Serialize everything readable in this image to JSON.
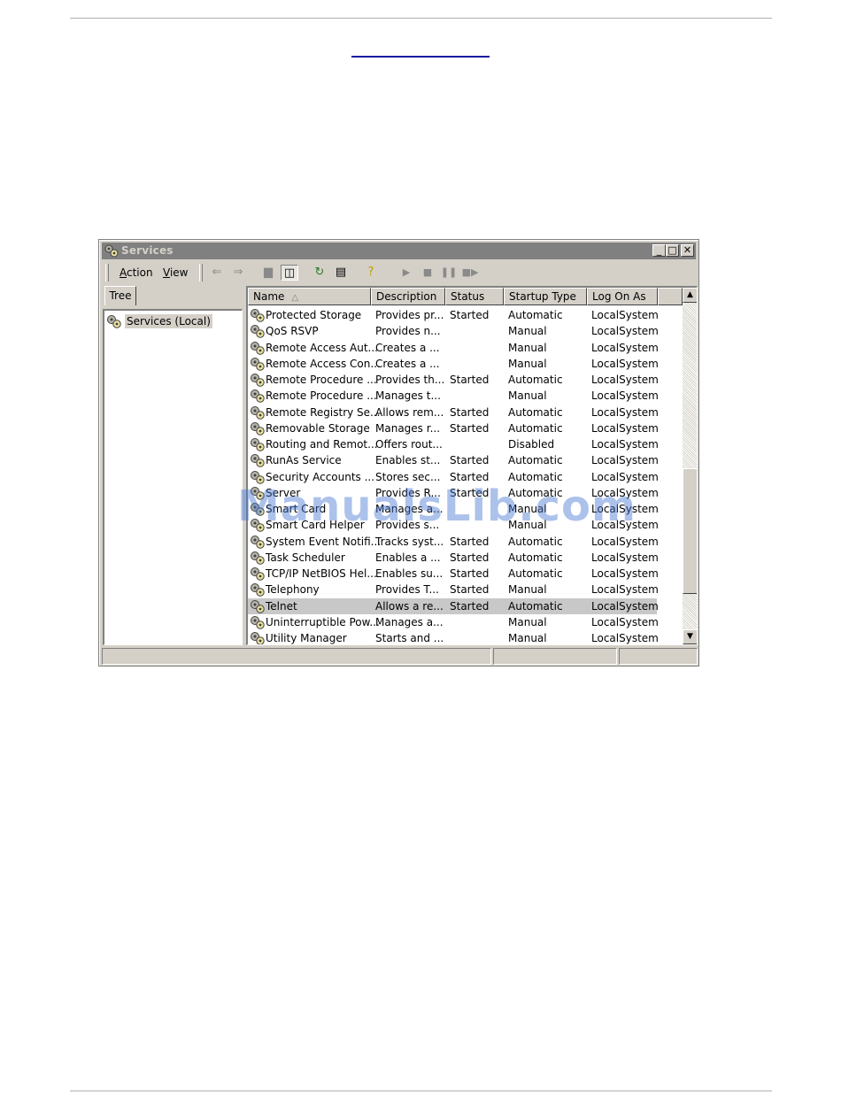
{
  "window": {
    "title": "Services",
    "minimize_glyph": "_",
    "maximize_glyph": "□",
    "close_glyph": "✕"
  },
  "menu": {
    "action": {
      "first": "A",
      "rest": "ction"
    },
    "view": {
      "first": "V",
      "rest": "iew"
    }
  },
  "toolbar_icons": [
    "back-arrow-icon",
    "forward-arrow-icon",
    "up-folder-icon",
    "show-hide-tree-icon",
    "refresh-icon",
    "export-list-icon",
    "help-icon",
    "start-service-icon",
    "stop-service-icon",
    "pause-service-icon",
    "restart-service-icon"
  ],
  "tree": {
    "tab_label": "Tree",
    "root_label": "Services (Local)"
  },
  "columns": {
    "name": "Name",
    "description": "Description",
    "status": "Status",
    "startup_type": "Startup Type",
    "log_on_as": "Log On As",
    "sort_glyph": "△"
  },
  "services": [
    {
      "name": "Protected Storage",
      "description": "Provides pr...",
      "status": "Started",
      "startup": "Automatic",
      "logon": "LocalSystem"
    },
    {
      "name": "QoS RSVP",
      "description": "Provides n...",
      "status": "",
      "startup": "Manual",
      "logon": "LocalSystem"
    },
    {
      "name": "Remote Access Aut...",
      "description": "Creates a ...",
      "status": "",
      "startup": "Manual",
      "logon": "LocalSystem"
    },
    {
      "name": "Remote Access Con...",
      "description": "Creates a ...",
      "status": "",
      "startup": "Manual",
      "logon": "LocalSystem"
    },
    {
      "name": "Remote Procedure ...",
      "description": "Provides th...",
      "status": "Started",
      "startup": "Automatic",
      "logon": "LocalSystem"
    },
    {
      "name": "Remote Procedure ...",
      "description": "Manages t...",
      "status": "",
      "startup": "Manual",
      "logon": "LocalSystem"
    },
    {
      "name": "Remote Registry Se...",
      "description": "Allows rem...",
      "status": "Started",
      "startup": "Automatic",
      "logon": "LocalSystem"
    },
    {
      "name": "Removable Storage",
      "description": "Manages r...",
      "status": "Started",
      "startup": "Automatic",
      "logon": "LocalSystem"
    },
    {
      "name": "Routing and Remot...",
      "description": "Offers rout...",
      "status": "",
      "startup": "Disabled",
      "logon": "LocalSystem"
    },
    {
      "name": "RunAs Service",
      "description": "Enables st...",
      "status": "Started",
      "startup": "Automatic",
      "logon": "LocalSystem"
    },
    {
      "name": "Security Accounts ...",
      "description": "Stores sec...",
      "status": "Started",
      "startup": "Automatic",
      "logon": "LocalSystem"
    },
    {
      "name": "Server",
      "description": "Provides R...",
      "status": "Started",
      "startup": "Automatic",
      "logon": "LocalSystem"
    },
    {
      "name": "Smart Card",
      "description": "Manages a...",
      "status": "",
      "startup": "Manual",
      "logon": "LocalSystem"
    },
    {
      "name": "Smart Card Helper",
      "description": "Provides s...",
      "status": "",
      "startup": "Manual",
      "logon": "LocalSystem"
    },
    {
      "name": "System Event Notifi...",
      "description": "Tracks syst...",
      "status": "Started",
      "startup": "Automatic",
      "logon": "LocalSystem"
    },
    {
      "name": "Task Scheduler",
      "description": "Enables a ...",
      "status": "Started",
      "startup": "Automatic",
      "logon": "LocalSystem"
    },
    {
      "name": "TCP/IP NetBIOS Hel...",
      "description": "Enables su...",
      "status": "Started",
      "startup": "Automatic",
      "logon": "LocalSystem"
    },
    {
      "name": "Telephony",
      "description": "Provides T...",
      "status": "Started",
      "startup": "Manual",
      "logon": "LocalSystem"
    },
    {
      "name": "Telnet",
      "description": "Allows a re...",
      "status": "Started",
      "startup": "Automatic",
      "logon": "LocalSystem",
      "selected": true
    },
    {
      "name": "Uninterruptible Pow...",
      "description": "Manages a...",
      "status": "",
      "startup": "Manual",
      "logon": "LocalSystem"
    },
    {
      "name": "Utility Manager",
      "description": "Starts and ...",
      "status": "",
      "startup": "Manual",
      "logon": "LocalSystem"
    }
  ],
  "scrollbar": {
    "up_glyph": "▲",
    "down_glyph": "▼"
  },
  "watermark": "ManualsLib.com",
  "colors": {
    "titlebar_inactive": "#808080",
    "selection": "#c8c8c8",
    "chrome": "#d4d0c8",
    "link": "#1a1aa0"
  }
}
